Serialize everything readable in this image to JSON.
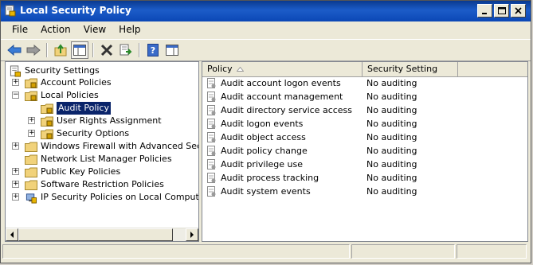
{
  "window": {
    "title": "Local Security Policy"
  },
  "menu": [
    "File",
    "Action",
    "View",
    "Help"
  ],
  "tree": {
    "root": "Security Settings",
    "items": [
      {
        "label": "Account Policies",
        "expander": "+"
      },
      {
        "label": "Local Policies",
        "expander": "−"
      },
      {
        "label": "Audit Policy",
        "expander": ""
      },
      {
        "label": "User Rights Assignment",
        "expander": "+"
      },
      {
        "label": "Security Options",
        "expander": "+"
      },
      {
        "label": "Windows Firewall with Advanced Security",
        "expander": "+"
      },
      {
        "label": "Network List Manager Policies",
        "expander": ""
      },
      {
        "label": "Public Key Policies",
        "expander": "+"
      },
      {
        "label": "Software Restriction Policies",
        "expander": "+"
      },
      {
        "label": "IP Security Policies on Local Computer",
        "expander": "+"
      }
    ]
  },
  "list": {
    "columns": [
      "Policy",
      "Security Setting"
    ],
    "rows": [
      {
        "policy": "Audit account logon events",
        "setting": "No auditing"
      },
      {
        "policy": "Audit account management",
        "setting": "No auditing"
      },
      {
        "policy": "Audit directory service access",
        "setting": "No auditing"
      },
      {
        "policy": "Audit logon events",
        "setting": "No auditing"
      },
      {
        "policy": "Audit object access",
        "setting": "No auditing"
      },
      {
        "policy": "Audit policy change",
        "setting": "No auditing"
      },
      {
        "policy": "Audit privilege use",
        "setting": "No auditing"
      },
      {
        "policy": "Audit process tracking",
        "setting": "No auditing"
      },
      {
        "policy": "Audit system events",
        "setting": "No auditing"
      }
    ]
  },
  "colors": {
    "titlebar": "#0a3a8f",
    "selection": "#0a246a",
    "folder": "#f1d27a"
  }
}
